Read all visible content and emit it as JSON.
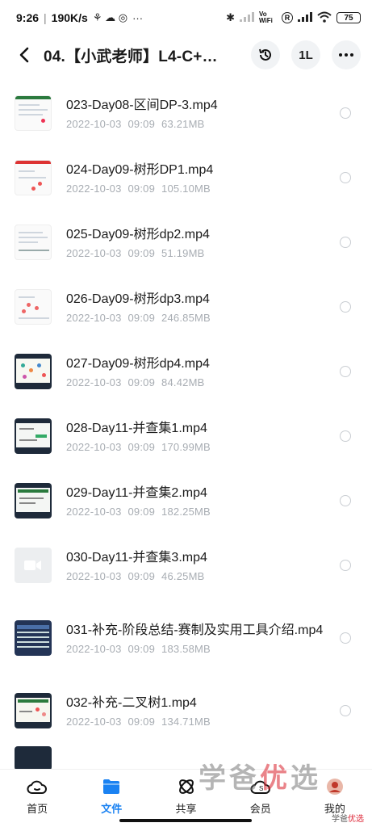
{
  "status_bar": {
    "time": "9:26",
    "speed": "190K/s",
    "extra_icons": "⚘ ☁ ◎",
    "more": "···",
    "bluetooth": "✱",
    "volte": "Vo WiFi",
    "battery": "75"
  },
  "header": {
    "title": "04.【小武老师】L4-C++...",
    "sort_label": "1L"
  },
  "files": [
    {
      "name": "023-Day08-区间DP-3.mp4",
      "date": "2022-10-03",
      "time": "09:09",
      "size": "63.21MB"
    },
    {
      "name": "024-Day09-树形DP1.mp4",
      "date": "2022-10-03",
      "time": "09:09",
      "size": "105.10MB"
    },
    {
      "name": "025-Day09-树形dp2.mp4",
      "date": "2022-10-03",
      "time": "09:09",
      "size": "51.19MB"
    },
    {
      "name": "026-Day09-树形dp3.mp4",
      "date": "2022-10-03",
      "time": "09:09",
      "size": "246.85MB"
    },
    {
      "name": "027-Day09-树形dp4.mp4",
      "date": "2022-10-03",
      "time": "09:09",
      "size": "84.42MB"
    },
    {
      "name": "028-Day11-并查集1.mp4",
      "date": "2022-10-03",
      "time": "09:09",
      "size": "170.99MB"
    },
    {
      "name": "029-Day11-并查集2.mp4",
      "date": "2022-10-03",
      "time": "09:09",
      "size": "182.25MB"
    },
    {
      "name": "030-Day11-并查集3.mp4",
      "date": "2022-10-03",
      "time": "09:09",
      "size": "46.25MB"
    },
    {
      "name": "031-补充-阶段总结-赛制及实用工具介绍.mp4",
      "date": "2022-10-03",
      "time": "09:09",
      "size": "183.58MB"
    },
    {
      "name": "032-补充-二叉树1.mp4",
      "date": "2022-10-03",
      "time": "09:09",
      "size": "134.71MB"
    }
  ],
  "bottom_nav": [
    {
      "label": "首页",
      "icon": "cloud-home-icon"
    },
    {
      "label": "文件",
      "icon": "folder-icon"
    },
    {
      "label": "共享",
      "icon": "share-icon"
    },
    {
      "label": "会员",
      "icon": "vip-icon"
    },
    {
      "label": "我的",
      "icon": "profile-icon"
    }
  ],
  "watermark": {
    "text_a": "学爸",
    "text_b": "优",
    "text_c": "选",
    "small_a": "学爸",
    "small_b": "优选"
  },
  "colors": {
    "accent": "#1a82f2",
    "meta_text": "#a8adb3"
  }
}
